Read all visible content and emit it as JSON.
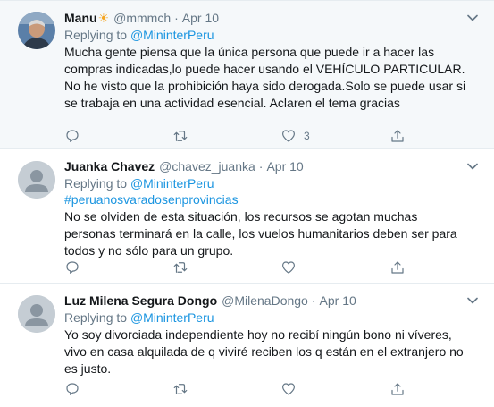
{
  "tweets": [
    {
      "name": "Manu",
      "name_emoji": "☀",
      "handle": "@mmmch",
      "separator": "·",
      "date": "Apr 10",
      "replying_prefix": "Replying to",
      "replying_handle": "@MininterPeru",
      "hashtag": "",
      "text": "Mucha gente piensa que la única persona que puede ir a hacer las compras indicadas,lo puede hacer usando el VEHÍCULO PARTICULAR. No he visto que la prohibición haya sido derogada.Solo se puede usar si se trabaja en una actividad esencial. Aclaren el tema gracias",
      "like_count": "3",
      "avatar": "photo",
      "highlighted": true
    },
    {
      "name": "Juanka Chavez",
      "handle": "@chavez_juanka",
      "separator": "·",
      "date": "Apr 10",
      "replying_prefix": "Replying to",
      "replying_handle": "@MininterPeru",
      "hashtag": "#peruanosvaradosenprovincias",
      "text": "No se olviden de esta situación, los recursos se agotan muchas personas terminará en la calle, los vuelos humanitarios deben ser para todos y no sólo para un grupo.",
      "like_count": "",
      "avatar": "default-avatar"
    },
    {
      "name": "Luz Milena Segura Dongo",
      "handle": "@MilenaDongo",
      "separator": "·",
      "date": "Apr 10",
      "replying_prefix": "Replying to",
      "replying_handle": "@MininterPeru",
      "hashtag": "",
      "text": "Yo soy divorciada independiente hoy no recibí ningún bono ni víveres, vivo en casa alquilada de q viviré reciben los q están en el extranjero no es justo.",
      "like_count": "",
      "avatar": "default-avatar"
    }
  ],
  "icons": {
    "reply": "reply-icon",
    "retweet": "retweet-icon",
    "like": "heart-icon",
    "share": "share-icon",
    "more": "chevron-down-icon"
  },
  "colors": {
    "link": "#1b95e0",
    "secondary_text": "#657786",
    "highlight_bg": "#f5f8fa",
    "divider": "#e6ecf0"
  }
}
